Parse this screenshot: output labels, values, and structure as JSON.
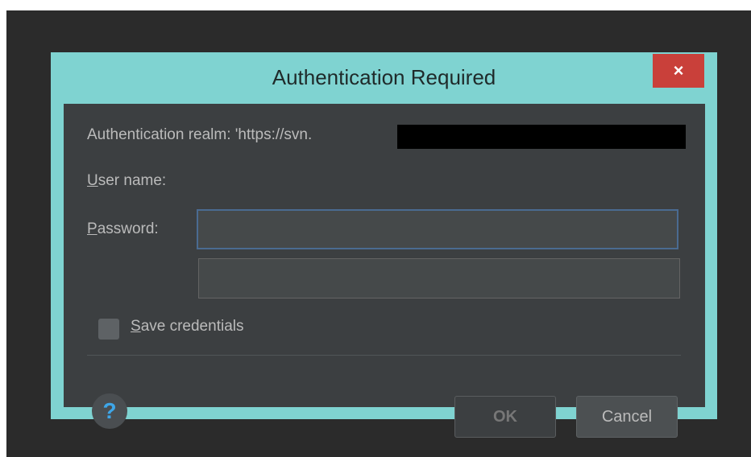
{
  "dialog": {
    "title": "Authentication Required",
    "close_label": "×"
  },
  "form": {
    "realm_text": "Authentication realm: 'https://svn.",
    "username": {
      "label_accel": "U",
      "label_rest": "ser name:",
      "value": ""
    },
    "password": {
      "label_accel": "P",
      "label_rest": "assword:",
      "value": ""
    },
    "save_credentials": {
      "label_accel": "S",
      "label_rest": "ave credentials",
      "checked": false
    }
  },
  "footer": {
    "help_glyph": "?",
    "ok_label": "OK",
    "cancel_label": "Cancel"
  },
  "colors": {
    "frame_accent": "#7fd3d1",
    "close_button": "#c9403a",
    "panel_bg": "#3c3f41",
    "focus_border": "#4a6b91",
    "help_icon": "#3ea6e8"
  }
}
